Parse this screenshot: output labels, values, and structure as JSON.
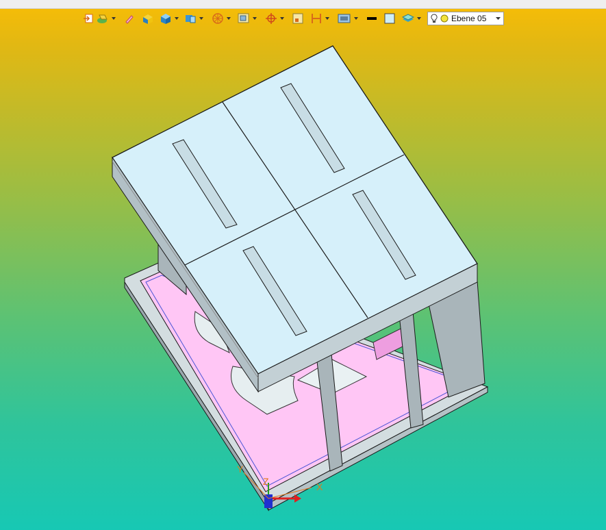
{
  "toolbar": {
    "buttons": [
      {
        "id": "import",
        "icon": "import-icon"
      },
      {
        "id": "material",
        "icon": "material-icon"
      },
      {
        "id": "pen",
        "icon": "pen-icon"
      },
      {
        "id": "solid-box",
        "icon": "box-yellow-icon"
      },
      {
        "id": "solid-blue",
        "icon": "box-blue-icon"
      },
      {
        "id": "view-cube",
        "icon": "view-cube-icon"
      },
      {
        "id": "sphere",
        "icon": "sphere-view-icon"
      },
      {
        "id": "zoom-window",
        "icon": "zoom-window-icon"
      },
      {
        "id": "target",
        "icon": "target-icon"
      },
      {
        "id": "dimension",
        "icon": "dimension-icon"
      },
      {
        "id": "frame",
        "icon": "frame-icon"
      },
      {
        "id": "render",
        "icon": "render-icon"
      },
      {
        "id": "line-color",
        "icon": "line-color-icon",
        "color": "#000000"
      },
      {
        "id": "fill-color",
        "icon": "fill-color-icon",
        "color": "#cfeef7"
      },
      {
        "id": "layers",
        "icon": "layers-icon"
      }
    ],
    "layer_select": {
      "value": "Ebene 05",
      "icons": [
        "lightbulb-icon",
        "layer-dot-icon"
      ]
    }
  },
  "scene": {
    "colors": {
      "roof": "#d6f0fa",
      "roof_side": "#b9c6cb",
      "wall": "#a9b5ba",
      "floor": "#ffc6f5",
      "base": "#d0dadd",
      "edge": "#1a1a1a"
    },
    "axes": {
      "x_label": "X",
      "y_label": "Y",
      "z_label": "Z"
    }
  }
}
